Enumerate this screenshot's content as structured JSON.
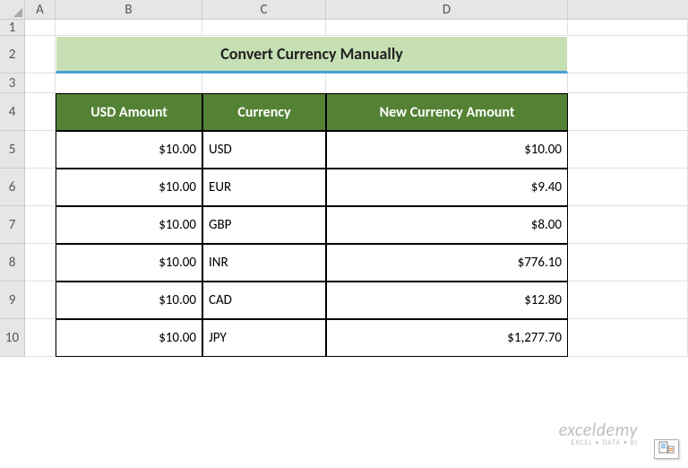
{
  "columns": [
    "A",
    "B",
    "C",
    "D"
  ],
  "rows": [
    "1",
    "2",
    "3",
    "4",
    "5",
    "6",
    "7",
    "8",
    "9",
    "10"
  ],
  "title": "Convert Currency Manually",
  "headers": {
    "usd": "USD Amount",
    "currency": "Currency",
    "new_amount": "New Currency Amount"
  },
  "data": [
    {
      "usd": "$10.00",
      "currency": "USD",
      "amount": "$10.00"
    },
    {
      "usd": "$10.00",
      "currency": "EUR",
      "amount": "$9.40"
    },
    {
      "usd": "$10.00",
      "currency": "GBP",
      "amount": "$8.00"
    },
    {
      "usd": "$10.00",
      "currency": "INR",
      "amount": "$776.10"
    },
    {
      "usd": "$10.00",
      "currency": "CAD",
      "amount": "$12.80"
    },
    {
      "usd": "$10.00",
      "currency": "JPY",
      "amount": "$1,277.70"
    }
  ],
  "watermark": {
    "brand": "exceldemy",
    "tagline": "EXCEL • DATA • BI"
  },
  "chart_data": {
    "type": "table",
    "title": "Convert Currency Manually",
    "columns": [
      "USD Amount",
      "Currency",
      "New Currency Amount"
    ],
    "rows": [
      [
        "$10.00",
        "USD",
        "$10.00"
      ],
      [
        "$10.00",
        "EUR",
        "$9.40"
      ],
      [
        "$10.00",
        "GBP",
        "$8.00"
      ],
      [
        "$10.00",
        "INR",
        "$776.10"
      ],
      [
        "$10.00",
        "CAD",
        "$12.80"
      ],
      [
        "$10.00",
        "JPY",
        "$1,277.70"
      ]
    ]
  }
}
